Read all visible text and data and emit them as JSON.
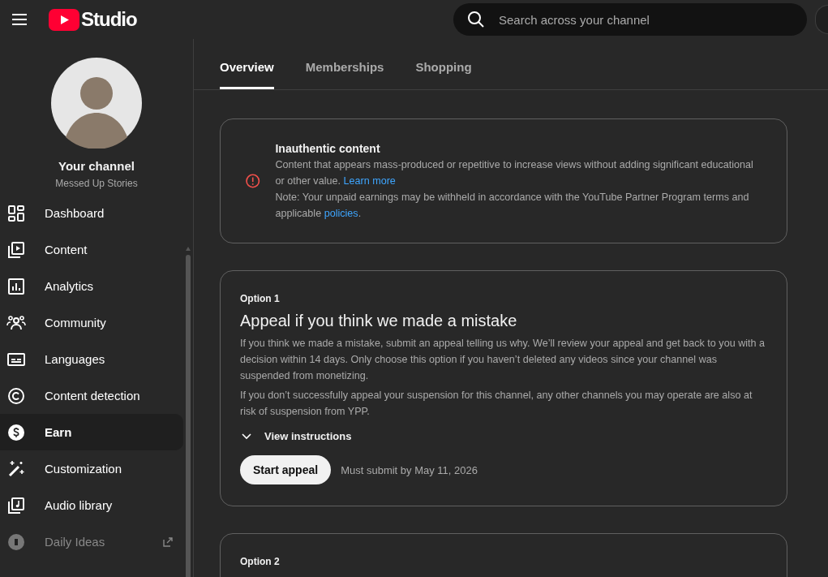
{
  "header": {
    "logo_text": "Studio",
    "search": {
      "placeholder": "Search across your channel"
    }
  },
  "channel": {
    "title": "Your channel",
    "name": "Messed Up Stories"
  },
  "sidebar": {
    "items": [
      {
        "label": "Dashboard",
        "selected": false,
        "kind": "page"
      },
      {
        "label": "Content",
        "selected": false,
        "kind": "page"
      },
      {
        "label": "Analytics",
        "selected": false,
        "kind": "page"
      },
      {
        "label": "Community",
        "selected": false,
        "kind": "page"
      },
      {
        "label": "Languages",
        "selected": false,
        "kind": "page"
      },
      {
        "label": "Content detection",
        "selected": false,
        "kind": "page"
      },
      {
        "label": "Earn",
        "selected": true,
        "kind": "page"
      },
      {
        "label": "Customization",
        "selected": false,
        "kind": "page"
      },
      {
        "label": "Audio library",
        "selected": false,
        "kind": "page"
      },
      {
        "label": "Daily Ideas",
        "selected": false,
        "kind": "external"
      }
    ]
  },
  "tabs": [
    {
      "label": "Overview",
      "selected": true
    },
    {
      "label": "Memberships",
      "selected": false
    },
    {
      "label": "Shopping",
      "selected": false
    }
  ],
  "notice": {
    "title": "Inauthentic content",
    "text": "Content that appears mass-produced or repetitive to increase views without adding significant educational or other value.",
    "link": "Learn more",
    "note": "Note: Your unpaid earnings may be withheld in accordance with the YouTube Partner Program terms and applicable",
    "note_link": "policies",
    "note_end": "."
  },
  "options": [
    {
      "label": "Option 1",
      "title": "Appeal if you think we made a mistake",
      "paragraphs": [
        "If you think we made a mistake, submit an appeal telling us why. We’ll review your appeal and get back to you with a decision within 14 days. Only choose this option if you haven’t deleted any videos since your channel was suspended from monetizing.",
        "If you don’t successfully appeal your suspension for this channel, any other channels you may operate are also at risk of suspension from YPP."
      ],
      "expander": "View instructions",
      "expanded": false,
      "button": "Start appeal",
      "deadline": "Must submit by May 11, 2026"
    },
    {
      "label": "Option 2"
    }
  ]
}
